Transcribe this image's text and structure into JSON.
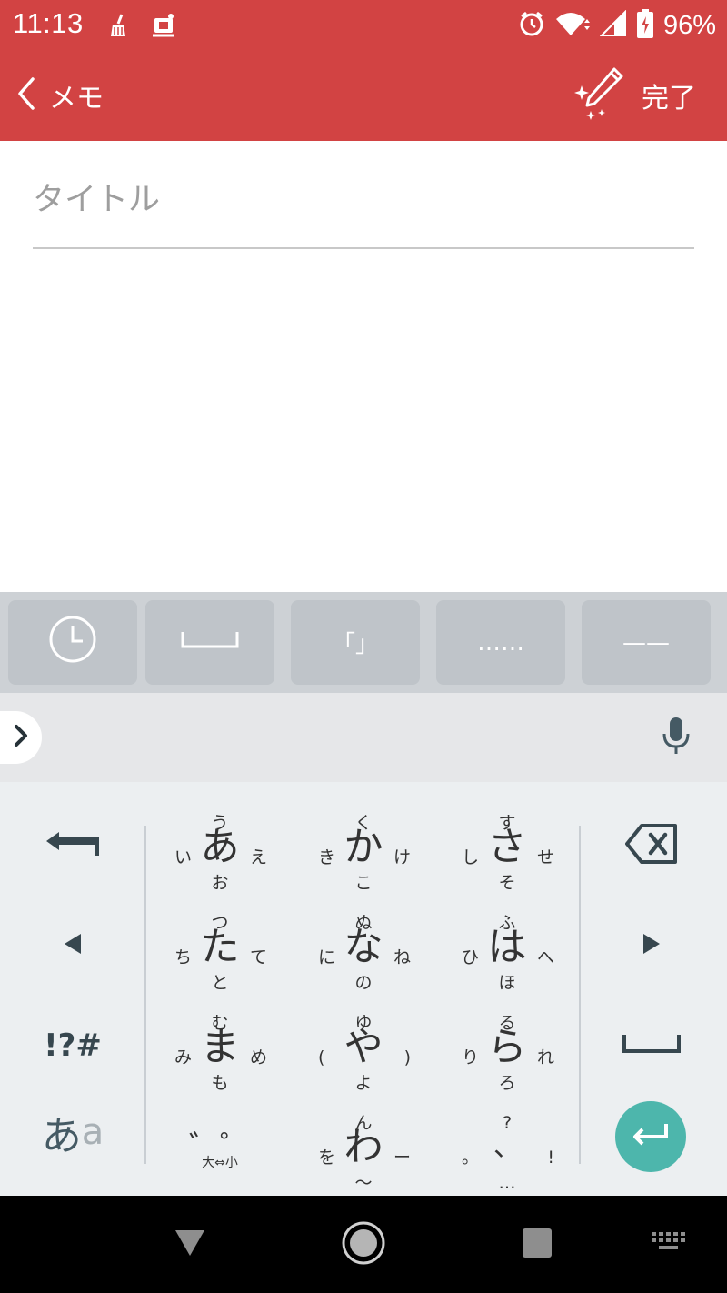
{
  "status_bar": {
    "time": "11:13",
    "battery_percent": "96%",
    "color": "#d24343",
    "notification_icons": [
      "broom-icon",
      "mahjong-icon"
    ],
    "system_icons": [
      "alarm-clock-icon",
      "wifi-icon",
      "signal-icon",
      "battery-charging-icon"
    ]
  },
  "app_bar": {
    "back_label": "メモ",
    "done_label": "完了",
    "accent_color": "#d24343"
  },
  "editor": {
    "title_placeholder": "タイトル",
    "title_value": "",
    "body_value": ""
  },
  "quick_keys": {
    "items": [
      {
        "icon": "clock-icon",
        "label": ""
      },
      {
        "icon": "space-bracket-icon",
        "label": ""
      },
      {
        "icon": "",
        "label": "「」"
      },
      {
        "icon": "",
        "label": "……"
      },
      {
        "icon": "",
        "label": "——"
      }
    ]
  },
  "keyboard": {
    "function_keys": {
      "undo": "undo-arrow-icon",
      "cursor_left": "cursor-left-icon",
      "symbols_label": "!?#",
      "mode_primary": "あ",
      "mode_secondary": "a",
      "backspace": "backspace-icon",
      "cursor_right": "cursor-right-icon",
      "space": "space-icon",
      "enter": "enter-icon"
    },
    "keys": [
      {
        "main": "あ",
        "top": "う",
        "left": "い",
        "right": "え",
        "bottom": "お"
      },
      {
        "main": "か",
        "top": "く",
        "left": "き",
        "right": "け",
        "bottom": "こ"
      },
      {
        "main": "さ",
        "top": "す",
        "left": "し",
        "right": "せ",
        "bottom": "そ"
      },
      {
        "main": "た",
        "top": "つ",
        "left": "ち",
        "right": "て",
        "bottom": "と"
      },
      {
        "main": "な",
        "top": "ぬ",
        "left": "に",
        "right": "ね",
        "bottom": "の"
      },
      {
        "main": "は",
        "top": "ふ",
        "left": "ひ",
        "right": "へ",
        "bottom": "ほ"
      },
      {
        "main": "ま",
        "top": "む",
        "left": "み",
        "right": "め",
        "bottom": "も"
      },
      {
        "main": "や",
        "top": "ゆ",
        "left": "(",
        "right": ")",
        "bottom": "よ"
      },
      {
        "main": "ら",
        "top": "る",
        "left": "り",
        "right": "れ",
        "bottom": "ろ"
      },
      {
        "main": "゛゜",
        "top": "",
        "left": "",
        "right": "",
        "bottom": "大⇔小"
      },
      {
        "main": "わ",
        "top": "ん",
        "left": "を",
        "right": "ー",
        "bottom": "〜"
      },
      {
        "main": "、",
        "top": "?",
        "left": "。",
        "right": "!",
        "bottom": "…"
      }
    ],
    "enter_color": "#4db6ac"
  },
  "nav_bar": {
    "back": "back-triangle-icon",
    "home": "home-circle-icon",
    "recents": "recents-square-icon",
    "keyboard": "keyboard-icon"
  }
}
